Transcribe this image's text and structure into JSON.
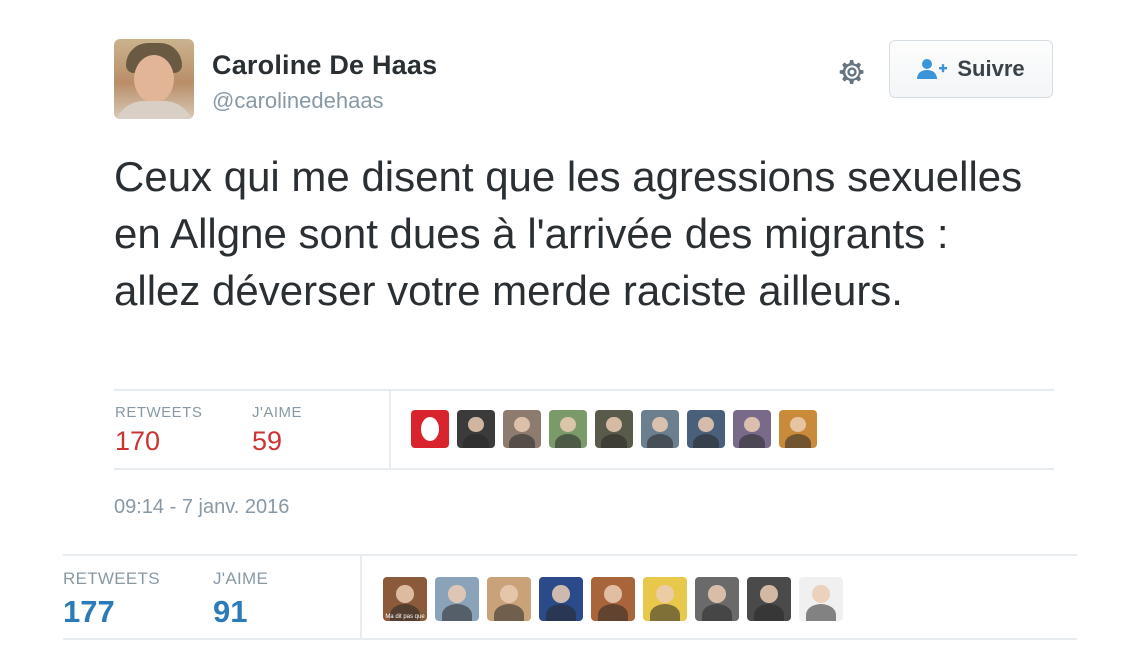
{
  "tweet": {
    "author_name": "Caroline De Haas",
    "author_handle": "@carolinedehaas",
    "follow_label": "Suivre",
    "text": "Ceux qui me disent que les agressions sexuelles en Allgne sont dues à l'arrivée des migrants : allez déverser votre merde raciste ailleurs.",
    "retweets_label": "RETWEETS",
    "retweets_count": "170",
    "likes_label": "J'AIME",
    "likes_count": "59",
    "timestamp": "09:14 - 7 janv. 2016",
    "liker_avatar_colors": [
      "#d9232d",
      "#3b3b3b",
      "#8c7b6e",
      "#7a9a6a",
      "#5a5a4a",
      "#6b7f8f",
      "#4a5f7a",
      "#7a6a8a",
      "#c98a3a"
    ],
    "liker_avatar_icons": [
      "logo-avatar",
      "person-avatar",
      "person-avatar",
      "person-avatar",
      "person-avatar",
      "person-avatar",
      "person-avatar",
      "person-avatar",
      "person-avatar"
    ]
  },
  "outer_stats": {
    "retweets_label": "RETWEETS",
    "retweets_count": "177",
    "likes_label": "J'AIME",
    "likes_count": "91",
    "baby_caption": "Ma dit pas que",
    "liker_avatar_colors": [
      "#8a5a3a",
      "#8aa3b8",
      "#c9a27a",
      "#2a4a8a",
      "#a8643a",
      "#e8c84a",
      "#6a6a6a",
      "#4a4a4a",
      "#f0f0f0"
    ],
    "liker_avatar_icons": [
      "baby-avatar",
      "landscape-avatar",
      "person-avatar",
      "flag-logo-avatar",
      "person-avatar",
      "cartoon-avatar",
      "people-avatar",
      "bw-person-avatar",
      "comic-avatar"
    ]
  }
}
